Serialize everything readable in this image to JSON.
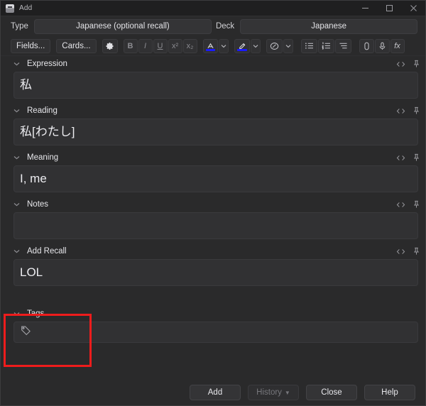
{
  "window": {
    "title": "Add",
    "app_icon": "anki-icon",
    "controls": {
      "minimize": "minimize-icon",
      "maximize": "maximize-icon",
      "close": "close-icon"
    }
  },
  "notetype_row": {
    "type_label": "Type",
    "type_value": "Japanese (optional recall)",
    "deck_label": "Deck",
    "deck_value": "Japanese"
  },
  "toolbar": {
    "fields_label": "Fields...",
    "cards_label": "Cards...",
    "settings_icon": "gear-icon",
    "bold_label": "B",
    "italic_label": "I",
    "underline_label": "U",
    "superscript_label": "x²",
    "subscript_label": "x₂",
    "text_color_icon": "text-color-icon",
    "text_color_value": "#1a1aff",
    "text_color_chevron": "chevron-down-icon",
    "highlight_icon": "highlighter-icon",
    "highlight_color_value": "#1a1aff",
    "highlight_chevron": "chevron-down-icon",
    "eraser_icon": "eraser-icon",
    "eraser_chevron": "chevron-down-icon",
    "bullet_list_icon": "bullet-list-icon",
    "numbered_list_icon": "numbered-list-icon",
    "justify_icon": "text-align-icon",
    "attachment_icon": "paperclip-icon",
    "record_icon": "microphone-icon",
    "mathjax_label": "fx"
  },
  "fields": [
    {
      "name": "Expression",
      "value": "私",
      "collapse_icon": "chevron-down-icon",
      "html_icon": "html-editor-icon",
      "pin_icon": "pin-icon"
    },
    {
      "name": "Reading",
      "value": "私[わたし]",
      "collapse_icon": "chevron-down-icon",
      "html_icon": "html-editor-icon",
      "pin_icon": "pin-icon"
    },
    {
      "name": "Meaning",
      "value": "I, me",
      "collapse_icon": "chevron-down-icon",
      "html_icon": "html-editor-icon",
      "pin_icon": "pin-icon"
    },
    {
      "name": "Notes",
      "value": "",
      "collapse_icon": "chevron-down-icon",
      "html_icon": "html-editor-icon",
      "pin_icon": "pin-icon"
    },
    {
      "name": "Add Recall",
      "value": "LOL",
      "collapse_icon": "chevron-down-icon",
      "html_icon": "html-editor-icon",
      "pin_icon": "pin-icon"
    }
  ],
  "tags": {
    "label": "Tags",
    "collapse_icon": "chevron-down-icon",
    "tag_icon": "tag-icon",
    "value": ""
  },
  "footer": {
    "add_label": "Add",
    "history_label": "History",
    "history_chevron": "▼",
    "close_label": "Close",
    "help_label": "Help"
  },
  "annotation": {
    "color": "#ee1c1c",
    "target": "Add Recall"
  }
}
